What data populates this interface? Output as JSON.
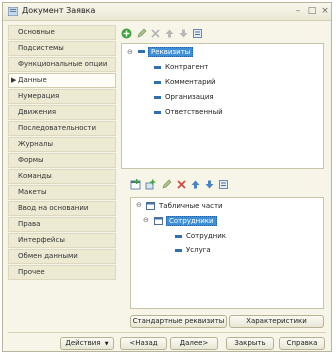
{
  "window": {
    "title": "Документ Заявка"
  },
  "nav": {
    "items": [
      {
        "label": "Основные"
      },
      {
        "label": "Подсистемы"
      },
      {
        "label": "Функциональные опции"
      },
      {
        "label": "Данные",
        "selected": true
      },
      {
        "label": "Нумерация"
      },
      {
        "label": "Движения"
      },
      {
        "label": "Последовательности"
      },
      {
        "label": "Журналы"
      },
      {
        "label": "Формы"
      },
      {
        "label": "Команды"
      },
      {
        "label": "Макеты"
      },
      {
        "label": "Ввод на основании"
      },
      {
        "label": "Права"
      },
      {
        "label": "Интерфейсы"
      },
      {
        "label": "Обмен данными"
      },
      {
        "label": "Прочее"
      }
    ]
  },
  "attributes_tree": {
    "root": "Реквизиты",
    "children": [
      "Контрагент",
      "Комментарий",
      "Организация",
      "Ответственный"
    ]
  },
  "tabular_tree": {
    "root": "Табличные части",
    "section": "Сотрудники",
    "children": [
      "Сотрудник",
      "Услуга"
    ]
  },
  "lower_buttons": {
    "standard_attributes": "Стандартные реквизиты",
    "characteristics": "Характеристики"
  },
  "footer": {
    "actions": "Действия",
    "back": "<Назад",
    "next": "Далее>",
    "close": "Закрыть",
    "help": "Справка"
  },
  "colors": {
    "selection": "#3e8fd8",
    "add_icon": "#3aa53a",
    "attribute_icon": "#2f6fb5"
  }
}
